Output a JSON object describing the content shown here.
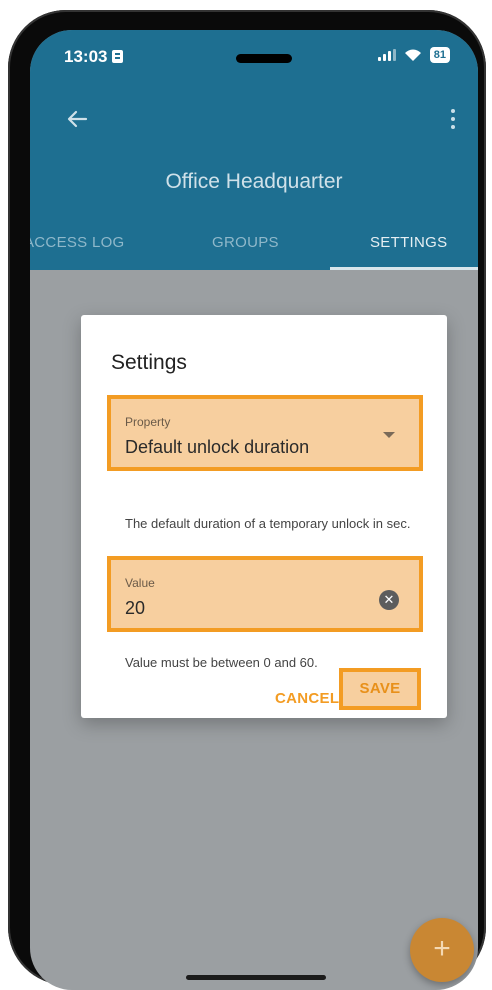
{
  "status_bar": {
    "time": "13:03",
    "battery": "81"
  },
  "header": {
    "title": "Office Headquarter"
  },
  "tabs": [
    {
      "label": "ACCESS LOG",
      "active": false
    },
    {
      "label": "GROUPS",
      "active": false
    },
    {
      "label": "SETTINGS",
      "active": true
    }
  ],
  "dialog": {
    "title": "Settings",
    "property": {
      "label": "Property",
      "value": "Default unlock duration"
    },
    "description": "The default duration of a temporary unlock in sec.",
    "value_field": {
      "label": "Value",
      "value": "20"
    },
    "hint": "Value must be between 0 and 60.",
    "cancel_label": "CANCEL",
    "save_label": "SAVE"
  },
  "fab": {
    "label": "+"
  },
  "colors": {
    "header": "#1e6f91",
    "accent": "#f39c23",
    "highlight_fill": "#f7cf9f",
    "overlay": "#9b9fa2"
  }
}
